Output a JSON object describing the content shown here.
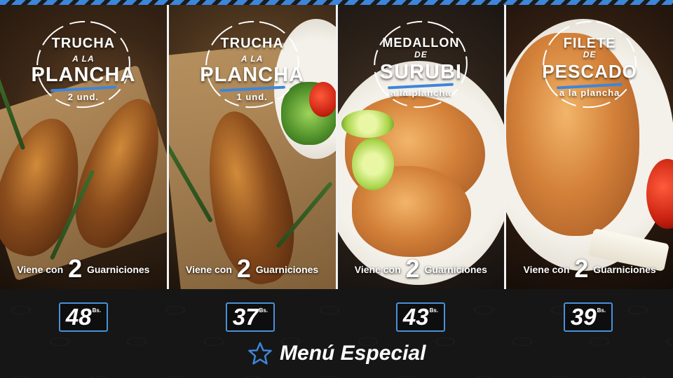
{
  "panels": [
    {
      "line1": "TRUCHA",
      "line2": "A LA",
      "line3": "PLANCHA",
      "note": "2 und.",
      "viene_prefix": "Viene con",
      "viene_number": "2",
      "viene_suffix": "Guarniciones",
      "price": "48",
      "currency": "Bs."
    },
    {
      "line1": "TRUCHA",
      "line2": "A LA",
      "line3": "PLANCHA",
      "note": "1 und.",
      "viene_prefix": "Viene con",
      "viene_number": "2",
      "viene_suffix": "Guarniciones",
      "price": "37",
      "currency": "Bs."
    },
    {
      "line1": "MEDALLON",
      "line2": "DE",
      "line3": "SURUBI",
      "note": "a la plancha",
      "viene_prefix": "Viene con",
      "viene_number": "2",
      "viene_suffix": "Guarniciones",
      "price": "43",
      "currency": "Bs."
    },
    {
      "line1": "FILETE",
      "line2": "DE",
      "line3": "PESCADO",
      "note": "a la plancha",
      "viene_prefix": "Viene con",
      "viene_number": "2",
      "viene_suffix": "Guarniciones",
      "price": "39",
      "currency": "Bs."
    }
  ],
  "footer": {
    "title": "Menú Especial",
    "icon": "star-icon"
  },
  "colors": {
    "accent": "#3d86d9",
    "background": "#161616"
  }
}
